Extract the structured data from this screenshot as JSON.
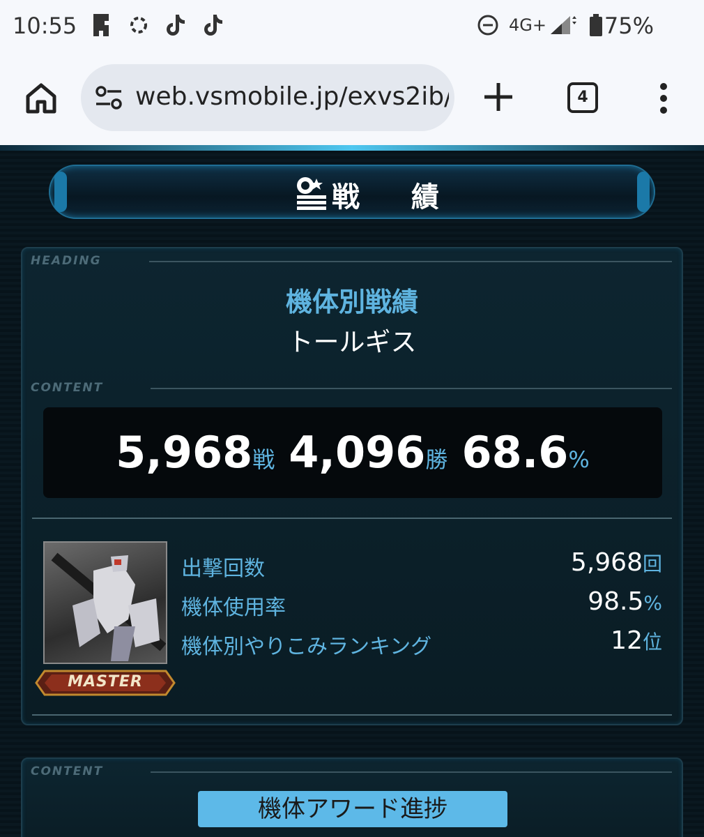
{
  "status_bar": {
    "time": "10:55",
    "network": "4G+",
    "battery": "75%",
    "notification_icons": [
      "puzzle-app-icon",
      "sync-icon",
      "tiktok-icon",
      "tiktok-icon"
    ]
  },
  "browser": {
    "url": "web.vsmobile.jp/exvs2ib/",
    "tab_count": "4"
  },
  "page": {
    "banner_title": "戦 績",
    "heading_tag": "HEADING",
    "content_tag": "CONTENT",
    "heading_title": "機体別戦績",
    "unit_name": "トールギス",
    "summary": {
      "battles": "5,968",
      "battles_unit": "戦",
      "wins": "4,096",
      "wins_unit": "勝",
      "win_rate": "68.6",
      "win_rate_unit": "%"
    },
    "badge": "MASTER",
    "stats": [
      {
        "label": "出撃回数",
        "value": "5,968",
        "unit": "回"
      },
      {
        "label": "機体使用率",
        "value": "98.5",
        "unit": "%"
      },
      {
        "label": "機体別やりこみランキング",
        "value": "12",
        "unit": "位"
      }
    ],
    "content_tag_2": "CONTENT",
    "award_button": "機体アワード進捗"
  },
  "colors": {
    "accent_blue": "#5fb4e0",
    "button_blue": "#5db9e8",
    "background": "#0a1820"
  }
}
